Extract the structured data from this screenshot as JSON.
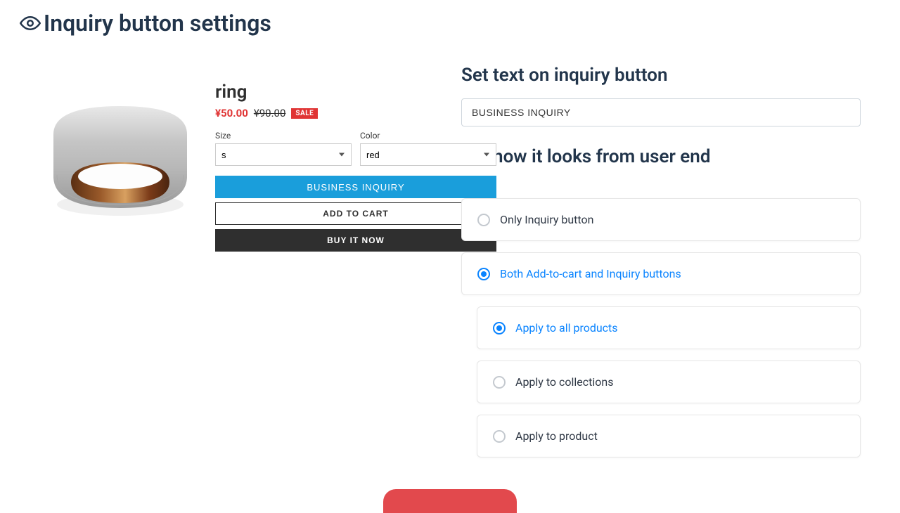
{
  "page": {
    "title": "Inquiry button settings"
  },
  "preview": {
    "product_name": "ring",
    "price": "¥50.00",
    "compare_price": "¥90.00",
    "sale_badge": "SALE",
    "size_label": "Size",
    "size_value": "s",
    "color_label": "Color",
    "color_value": "red",
    "inquiry_button": "BUSINESS INQUIRY",
    "add_to_cart": "ADD TO CART",
    "buy_it_now": "BUY IT NOW"
  },
  "settings": {
    "text_heading": "Set text on inquiry button",
    "text_value": "BUSINESS INQUIRY",
    "looks_heading": "Set how it looks from user end",
    "options": {
      "only_inquiry": {
        "label": "Only Inquiry button",
        "selected": false
      },
      "both": {
        "label": "Both Add-to-cart and Inquiry buttons",
        "selected": true
      },
      "apply_all": {
        "label": "Apply to all products",
        "selected": true
      },
      "apply_collections": {
        "label": "Apply to collections",
        "selected": false
      },
      "apply_product": {
        "label": "Apply to product",
        "selected": false
      }
    }
  }
}
